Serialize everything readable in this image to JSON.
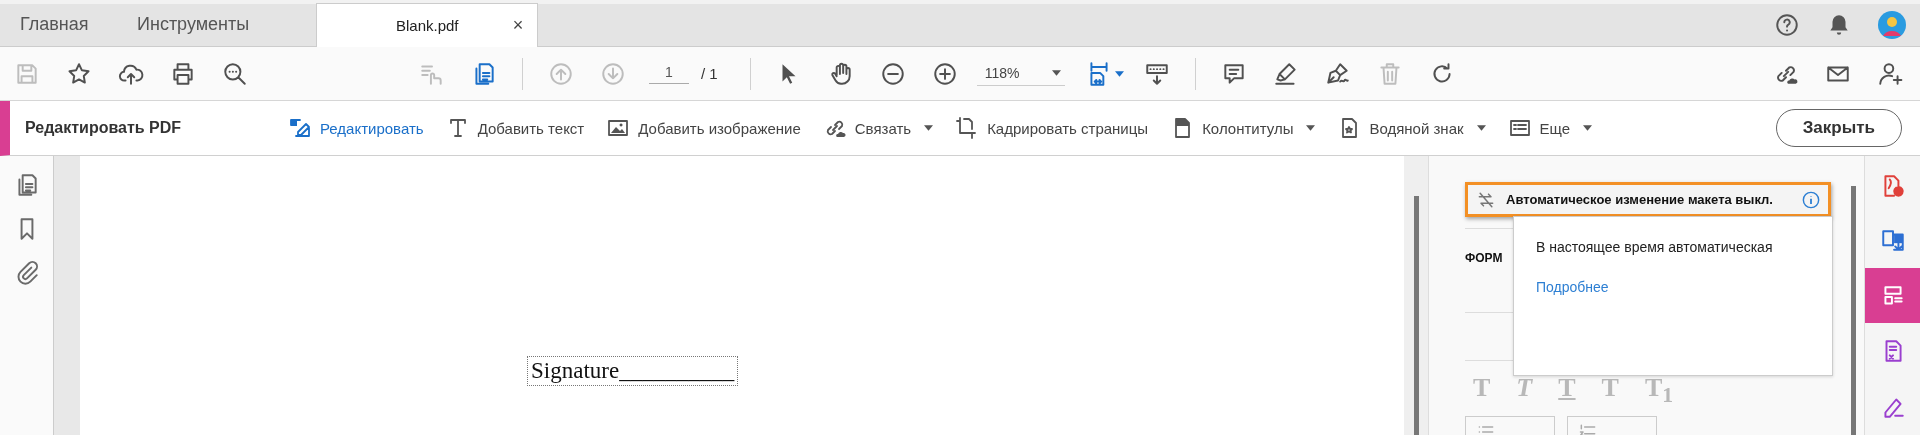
{
  "tabs": [
    {
      "label": "Главная",
      "selected": false
    },
    {
      "label": "Инструменты",
      "selected": false
    },
    {
      "label": "Blank.pdf",
      "selected": true,
      "close": "×"
    }
  ],
  "toolbar": {
    "file_tools": [
      {
        "kind": "save",
        "disabled": true
      },
      {
        "kind": "star",
        "disabled": false
      },
      {
        "kind": "upload",
        "disabled": false
      },
      {
        "kind": "print",
        "disabled": false
      },
      {
        "kind": "search",
        "disabled": false
      }
    ],
    "view_tools": [
      {
        "kind": "touch",
        "disabled": true
      },
      {
        "kind": "pages",
        "disabled": false
      }
    ],
    "page_nav": {
      "tools": [
        {
          "kind": "arrow-up",
          "disabled": true
        },
        {
          "kind": "arrow-down",
          "disabled": true
        }
      ],
      "page": "1",
      "total": "/ 1"
    },
    "nav_tools": [
      {
        "kind": "pointer",
        "disabled": false
      },
      {
        "kind": "hand",
        "disabled": false
      },
      {
        "kind": "zoom-out",
        "disabled": false
      },
      {
        "kind": "zoom-in",
        "disabled": false
      }
    ],
    "zoom": "118%",
    "layout_tools": [
      {
        "kind": "fit-width",
        "disabled": false
      },
      {
        "kind": "scroll",
        "disabled": false
      }
    ],
    "mark_tools": [
      {
        "kind": "comment",
        "disabled": false
      },
      {
        "kind": "highlighter",
        "disabled": false
      },
      {
        "kind": "pen",
        "disabled": false
      },
      {
        "kind": "trash",
        "disabled": true
      },
      {
        "kind": "rotate",
        "disabled": false
      }
    ],
    "share_tools": [
      {
        "kind": "link",
        "disabled": false
      },
      {
        "kind": "mail",
        "disabled": false
      },
      {
        "kind": "add-user",
        "disabled": false
      }
    ]
  },
  "edit_bar": {
    "title": "Редактировать PDF",
    "tools": [
      {
        "kind": "edit",
        "label": "Редактировать",
        "selected": true,
        "dropdown": false
      },
      {
        "kind": "text",
        "label": "Добавить текст",
        "selected": false,
        "dropdown": false
      },
      {
        "kind": "image",
        "label": "Добавить изображение",
        "selected": false,
        "dropdown": false
      },
      {
        "kind": "link",
        "label": "Связать",
        "selected": false,
        "dropdown": true
      },
      {
        "kind": "crop",
        "label": "Кадрировать страницы",
        "selected": false,
        "dropdown": false
      },
      {
        "kind": "header",
        "label": "Колонтитулы",
        "selected": false,
        "dropdown": true
      },
      {
        "kind": "watermark",
        "label": "Водяной знак",
        "selected": false,
        "dropdown": true
      },
      {
        "kind": "more",
        "label": "Еще",
        "selected": false,
        "dropdown": true
      }
    ],
    "close_button": "Закрыть"
  },
  "left_rail": [
    {
      "kind": "pages"
    },
    {
      "kind": "bookmark"
    },
    {
      "kind": "attachment"
    }
  ],
  "document": {
    "field": "Signature__________"
  },
  "format_panel": {
    "layout_toggle": {
      "label": "Автоматическое изменение макета выкл.",
      "highlighted": true
    },
    "section_label": "ФОРМ",
    "popup": {
      "text": "В настоящее время автоматическая",
      "link": "Подробнее"
    },
    "format_buttons": [
      {
        "kind": "bold",
        "label": "T"
      },
      {
        "kind": "italic",
        "label": "T"
      },
      {
        "kind": "underline",
        "label": "T"
      },
      {
        "kind": "superscript",
        "label": "T"
      },
      {
        "kind": "subscript",
        "label": "T$_{1}$"
      }
    ],
    "list_buttons": [
      {
        "kind": "bullets"
      },
      {
        "kind": "numbers"
      }
    ]
  },
  "right_rail": [
    {
      "kind": "create-pdf",
      "selected": false
    },
    {
      "kind": "export",
      "selected": false
    },
    {
      "kind": "organize",
      "selected": true
    },
    {
      "kind": "form",
      "selected": false
    },
    {
      "kind": "sign",
      "selected": false
    }
  ]
}
